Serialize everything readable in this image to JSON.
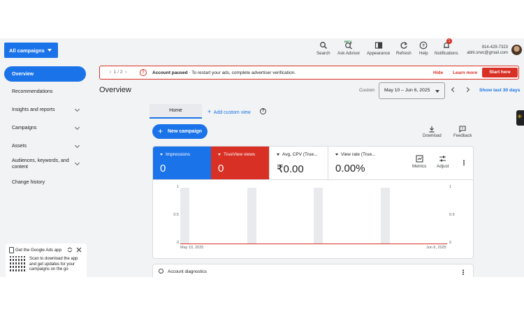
{
  "header": {
    "scope_label": "All campaigns",
    "tools": [
      {
        "label": "Search",
        "icon": "search-icon"
      },
      {
        "label": "Ask Advisor",
        "icon": "sparkle-icon",
        "badge": "BETA"
      },
      {
        "label": "Appearance",
        "icon": "appearance-icon"
      },
      {
        "label": "Refresh",
        "icon": "refresh-icon"
      },
      {
        "label": "Help",
        "icon": "help-icon"
      },
      {
        "label": "Notifications",
        "icon": "bell-icon",
        "count": "1"
      }
    ],
    "account_id": "914-429-7323",
    "account_email": "abhi.srwc@gmail.com"
  },
  "sidebar": {
    "items": [
      {
        "label": "Overview"
      },
      {
        "label": "Recommendations"
      },
      {
        "label": "Insights and reports"
      },
      {
        "label": "Campaigns"
      },
      {
        "label": "Assets"
      },
      {
        "label": "Audiences, keywords, and content"
      },
      {
        "label": "Change history"
      }
    ],
    "app_card": {
      "title": "Get the Google Ads app",
      "desc": "Scan to download the app and get updates for your campaigns on the go"
    }
  },
  "alert": {
    "pager": "1 / 2",
    "title": "Account paused",
    "message": " · To restart your ads, complete advertiser verification.",
    "hide": "Hide",
    "learn_more": "Learn more",
    "start": "Start here"
  },
  "overview": {
    "title": "Overview",
    "custom_label": "Custom",
    "date_range": "May 10 – Jun 6, 2025",
    "show_last": "Show last 30 days"
  },
  "tabs": {
    "home": "Home",
    "add_custom_view": "Add custom view"
  },
  "actions": {
    "new_campaign": "New campaign",
    "download": "Download",
    "feedback": "Feedback"
  },
  "metrics": [
    {
      "label": "Impressions",
      "value": "0",
      "color": "#1a73e8"
    },
    {
      "label": "TrueView views",
      "value": "0",
      "color": "#d93025"
    },
    {
      "label": "Avg. CPV (True...",
      "value": "₹0.00"
    },
    {
      "label": "View rate (True...",
      "value": "0.00%"
    }
  ],
  "card_tools": {
    "metrics": "Metrics",
    "adjust": "Adjust"
  },
  "chart_data": {
    "type": "line",
    "x": [
      "May 10, 2025",
      "Jun 6, 2025"
    ],
    "series": [
      {
        "values": [
          0,
          0
        ],
        "color": "#1a73e8"
      },
      {
        "values": [
          0,
          0
        ],
        "color": "#d93025"
      }
    ],
    "y_ticks_left": [
      "1",
      "0.5",
      "0"
    ],
    "y_ticks_right": [
      "1",
      "0.5",
      "0"
    ],
    "ylim": [
      0,
      1
    ],
    "weekend_bands": 4
  },
  "diagnostics": {
    "title": "Account diagnostics"
  }
}
